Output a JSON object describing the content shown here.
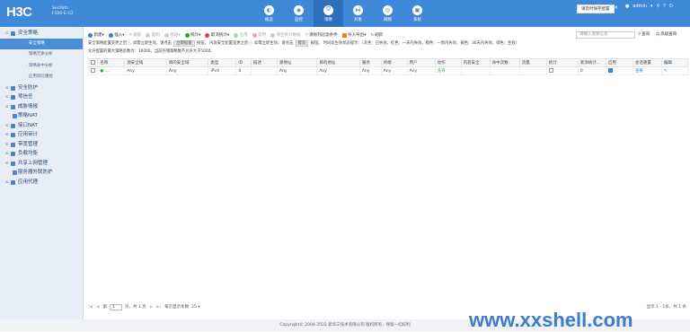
{
  "header": {
    "logo": "H3C",
    "model_line1": "SecPath",
    "model_line2": "F100-E-G2",
    "nav": [
      {
        "label": "概览",
        "icon": "dashboard-icon"
      },
      {
        "label": "监控",
        "icon": "monitor-icon"
      },
      {
        "label": "策略",
        "icon": "policy-icon",
        "active": true
      },
      {
        "label": "对象",
        "icon": "object-icon"
      },
      {
        "label": "网络",
        "icon": "network-icon"
      },
      {
        "label": "系统",
        "icon": "system-icon"
      }
    ],
    "alert": "请及时保存配置",
    "alert_close": "×",
    "user": "admin"
  },
  "sidebar": {
    "sections": [
      {
        "label": "安全策略",
        "expanded": true,
        "children": [
          {
            "label": "安全策略",
            "active": true
          },
          {
            "label": "策略冗余分析"
          },
          {
            "label": "策略命中分析"
          },
          {
            "label": "应用风险爆扰"
          }
        ]
      },
      {
        "label": "安全防护"
      },
      {
        "label": "零信任"
      },
      {
        "label": "威胁情报"
      }
    ],
    "leaves": [
      "策略NAT",
      "接口NAT"
    ],
    "sections2": [
      {
        "label": "应用审计"
      },
      {
        "label": "带宽管理"
      },
      {
        "label": "负载均衡"
      },
      {
        "label": "共享上网管理"
      }
    ],
    "leaf2": "服务器外联防护",
    "last": "应用代理"
  },
  "toolbar": {
    "buttons": [
      {
        "label": "新建",
        "color": "#3a7fd5"
      },
      {
        "label": "插入",
        "color": "#3a7fd5"
      },
      {
        "label": "删除",
        "color": "#e04040",
        "disabled": true
      },
      {
        "label": "复制",
        "color": "#aaaaaa",
        "disabled": true
      },
      {
        "label": "移动",
        "color": "#aaaaaa",
        "disabled": true
      },
      {
        "label": "统计",
        "color": "#3a9a3a"
      },
      {
        "label": "取消统计",
        "color": "#e04040"
      },
      {
        "label": "启用",
        "color": "#3a9a3a",
        "disabled": true
      },
      {
        "label": "禁用",
        "color": "#e04040",
        "disabled": true
      },
      {
        "label": "清空统计数据",
        "color": "#aaaaaa",
        "disabled": true
      },
      {
        "label": "清除列过滤条件",
        "color": "#3a7fd5"
      },
      {
        "label": "导入导出",
        "color": "#e08a20"
      },
      {
        "label": "刷新",
        "color": "#3a7fd5"
      }
    ],
    "search_placeholder": "请输入搜索信息",
    "search_label": "查询",
    "advanced_label": "高级查询"
  },
  "info": {
    "line1_a": "安全策略配置变更之后",
    "line1_b": "如需立即生效，请点击",
    "line1_btn1": "立即加速",
    "line1_c": "按钮。 内容安全配置变更之后",
    "line1_d": "如需立即生效，请点击",
    "line1_btn2": "提交",
    "line1_e": "按钮。 时间段生效状态提示：（灰色：已失效，红色：一天内失效，橙色：一周内失效，黄色：30天内失效，绿色：生效）",
    "line2": "允许配置的最大策略总数为：10000。当前存储策略数不允许大于5000。"
  },
  "table": {
    "columns": [
      "名称",
      "源安全域",
      "目的安全域",
      "类型",
      "ID",
      "描述",
      "源地址",
      "目的地址",
      "服务",
      "终端",
      "用户",
      "动作",
      "内容安全",
      "命中次数",
      "流量",
      "统计",
      "新添统计...",
      "启用",
      "会话重置",
      "编辑"
    ],
    "rows": [
      [
        "...",
        "Any",
        "Any",
        "IPv4",
        "0",
        "",
        "Any",
        "Any",
        "Any",
        "Any",
        "Any",
        "允许",
        "",
        "",
        "",
        "",
        "0",
        "",
        "查看",
        ""
      ]
    ]
  },
  "pager": {
    "first": "|◀",
    "prev": "◀",
    "page_prefix": "第",
    "page": "1",
    "page_suffix": "页，共 1 页",
    "next": "▶",
    "last": "▶|",
    "per_page_label": "每页显示条数",
    "per_page": "25",
    "summary": "显示 1 - 1条，共 1 条"
  },
  "footer": "Copyright© 2004-2022 新华三技术有限公司 版权所有，保留一切权利",
  "watermark": "www.xxshell.com"
}
